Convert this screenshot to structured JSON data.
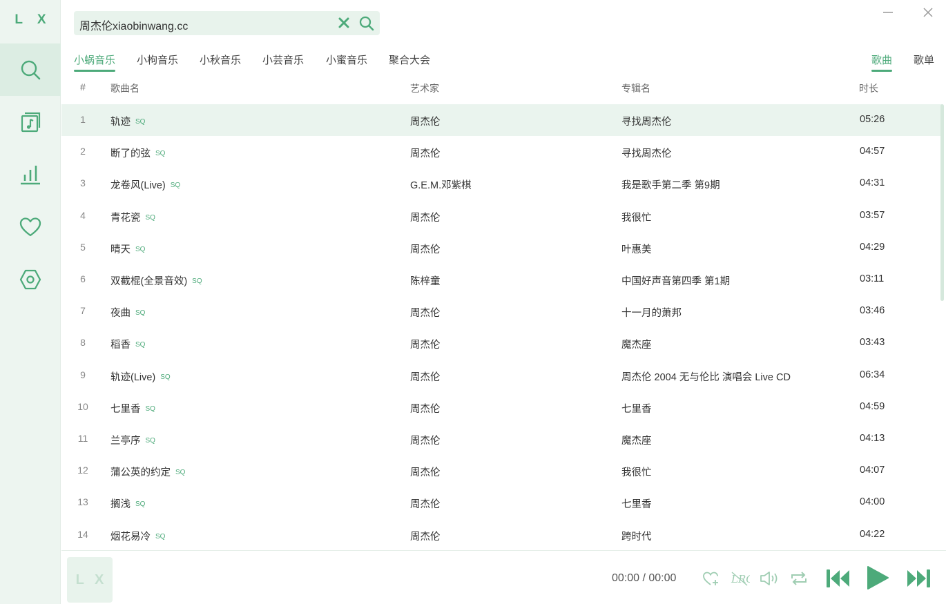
{
  "app": {
    "logo": "L X"
  },
  "sidebar": {
    "items": [
      {
        "icon": "search-icon",
        "active": true
      },
      {
        "icon": "music-list-icon",
        "active": false
      },
      {
        "icon": "leaderboard-icon",
        "active": false
      },
      {
        "icon": "heart-icon",
        "active": false
      },
      {
        "icon": "settings-icon",
        "active": false
      }
    ]
  },
  "search": {
    "value": "周杰伦xiaobinwang.cc"
  },
  "sources": [
    "小蜗音乐",
    "小枸音乐",
    "小秋音乐",
    "小芸音乐",
    "小蜜音乐",
    "聚合大会"
  ],
  "active_source": "小蜗音乐",
  "type_tabs": [
    "歌曲",
    "歌单"
  ],
  "active_type": "歌曲",
  "table": {
    "headers": {
      "num": "#",
      "name": "歌曲名",
      "artist": "艺术家",
      "album": "专辑名",
      "duration": "时长"
    },
    "quality_badge": "SQ",
    "rows": [
      {
        "num": "1",
        "name": "轨迹",
        "artist": "周杰伦",
        "album": "寻找周杰伦",
        "duration": "05:26"
      },
      {
        "num": "2",
        "name": "断了的弦",
        "artist": "周杰伦",
        "album": "寻找周杰伦",
        "duration": "04:57"
      },
      {
        "num": "3",
        "name": "龙卷风(Live)",
        "artist": "G.E.M.邓紫棋",
        "album": "我是歌手第二季 第9期",
        "duration": "04:31"
      },
      {
        "num": "4",
        "name": "青花瓷",
        "artist": "周杰伦",
        "album": "我很忙",
        "duration": "03:57"
      },
      {
        "num": "5",
        "name": "晴天",
        "artist": "周杰伦",
        "album": "叶惠美",
        "duration": "04:29"
      },
      {
        "num": "6",
        "name": "双截棍(全景音效)",
        "artist": "陈梓童",
        "album": "中国好声音第四季 第1期",
        "duration": "03:11"
      },
      {
        "num": "7",
        "name": "夜曲",
        "artist": "周杰伦",
        "album": "十一月的萧邦",
        "duration": "03:46"
      },
      {
        "num": "8",
        "name": "稻香",
        "artist": "周杰伦",
        "album": "魔杰座",
        "duration": "03:43"
      },
      {
        "num": "9",
        "name": "轨迹(Live)",
        "artist": "周杰伦",
        "album": "周杰伦 2004 无与伦比 演唱会 Live CD",
        "duration": "06:34"
      },
      {
        "num": "10",
        "name": "七里香",
        "artist": "周杰伦",
        "album": "七里香",
        "duration": "04:59"
      },
      {
        "num": "11",
        "name": "兰亭序",
        "artist": "周杰伦",
        "album": "魔杰座",
        "duration": "04:13"
      },
      {
        "num": "12",
        "name": "蒲公英的约定",
        "artist": "周杰伦",
        "album": "我很忙",
        "duration": "04:07"
      },
      {
        "num": "13",
        "name": "搁浅",
        "artist": "周杰伦",
        "album": "七里香",
        "duration": "04:00"
      },
      {
        "num": "14",
        "name": "烟花易冷",
        "artist": "周杰伦",
        "album": "跨时代",
        "duration": "04:22"
      }
    ]
  },
  "player": {
    "cover_text": "L X",
    "time": "00:00 / 00:00"
  },
  "colors": {
    "accent": "#4daa7a",
    "sidebar_bg": "#edf5f0",
    "selected_row": "#eaf4ee"
  }
}
